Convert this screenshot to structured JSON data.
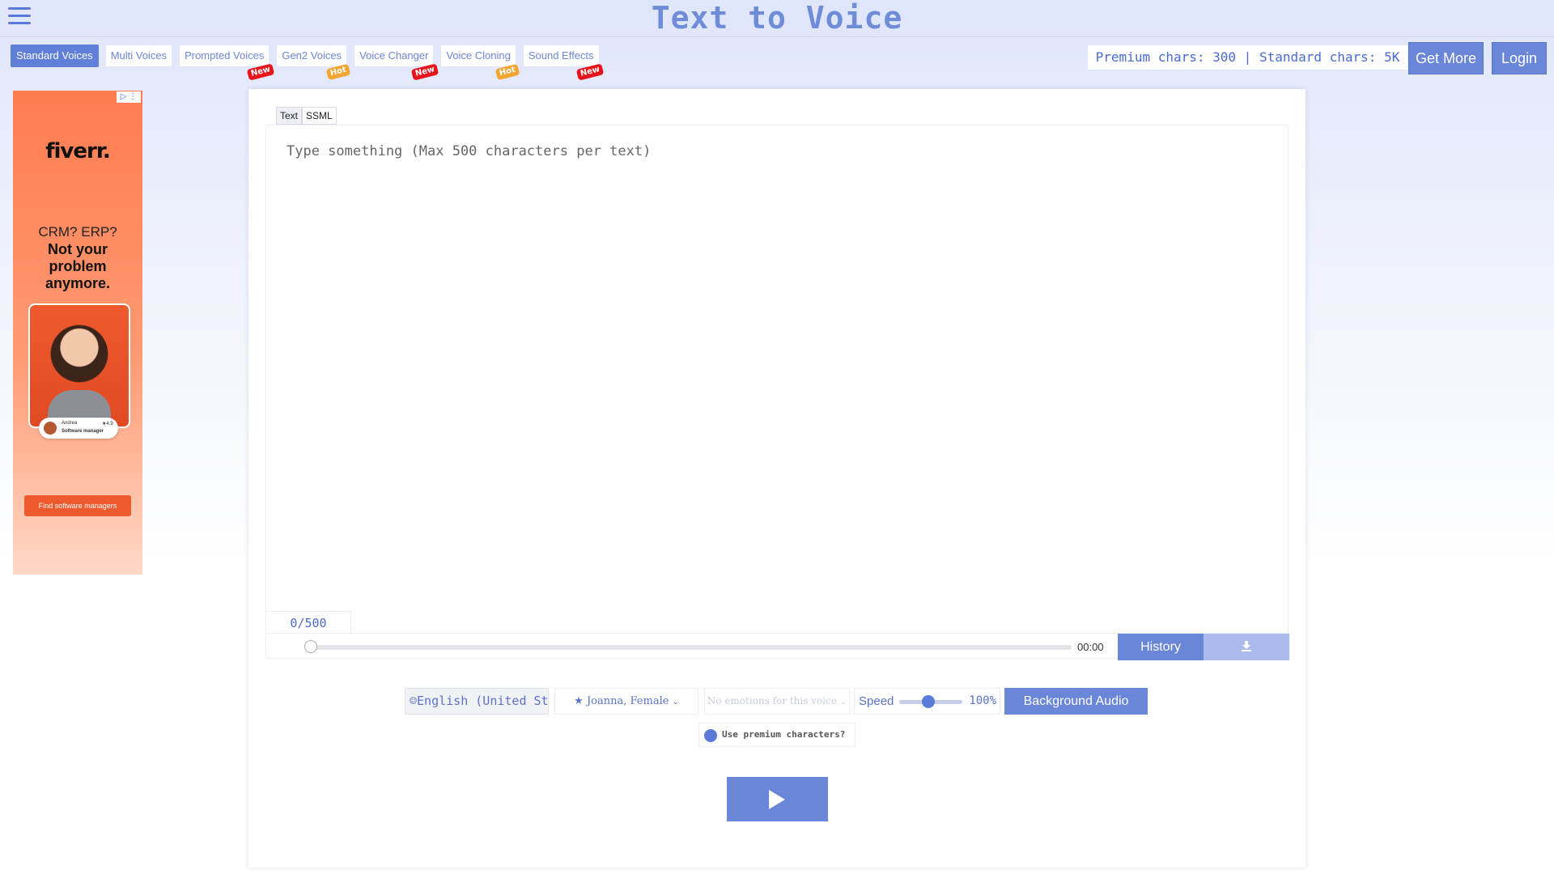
{
  "app": {
    "title": "Text to Voice"
  },
  "tabs": [
    {
      "label": "Standard Voices",
      "badge": ""
    },
    {
      "label": "Multi Voices",
      "badge": ""
    },
    {
      "label": "Prompted Voices",
      "badge": "New"
    },
    {
      "label": "Gen2 Voices",
      "badge": "Hot"
    },
    {
      "label": "Voice Changer",
      "badge": "New"
    },
    {
      "label": "Voice Cloning",
      "badge": "Hot"
    },
    {
      "label": "Sound Effects",
      "badge": "New"
    }
  ],
  "header": {
    "chars_info": "Premium chars: 300 | Standard chars: 5K",
    "get_more": "Get More",
    "login": "Login"
  },
  "ad": {
    "brand": "fiverr.",
    "line1": "CRM? ERP?",
    "line2": "Not your problem anymore.",
    "person_name": "Andrea",
    "person_role": "Software manager",
    "rating": "★4.9",
    "cta": "Find software managers"
  },
  "editor": {
    "mode_tabs": [
      "Text",
      "SSML"
    ],
    "placeholder": "Type something (Max 500 characters per text)",
    "value": "",
    "counter": "0/500"
  },
  "player": {
    "time": "00:00",
    "history": "History"
  },
  "controls": {
    "language": "English (United States)",
    "voice": "Joanna, Female",
    "emotion": "No emotions for this voice",
    "speed_label": "Speed",
    "speed_value": "100%",
    "speed_fraction": 0.46,
    "background_audio": "Background Audio",
    "premium_label": "Use premium characters?"
  },
  "colors": {
    "accent": "#6a86d8",
    "badge_new": "#e8131b",
    "badge_hot": "#f3a532"
  }
}
